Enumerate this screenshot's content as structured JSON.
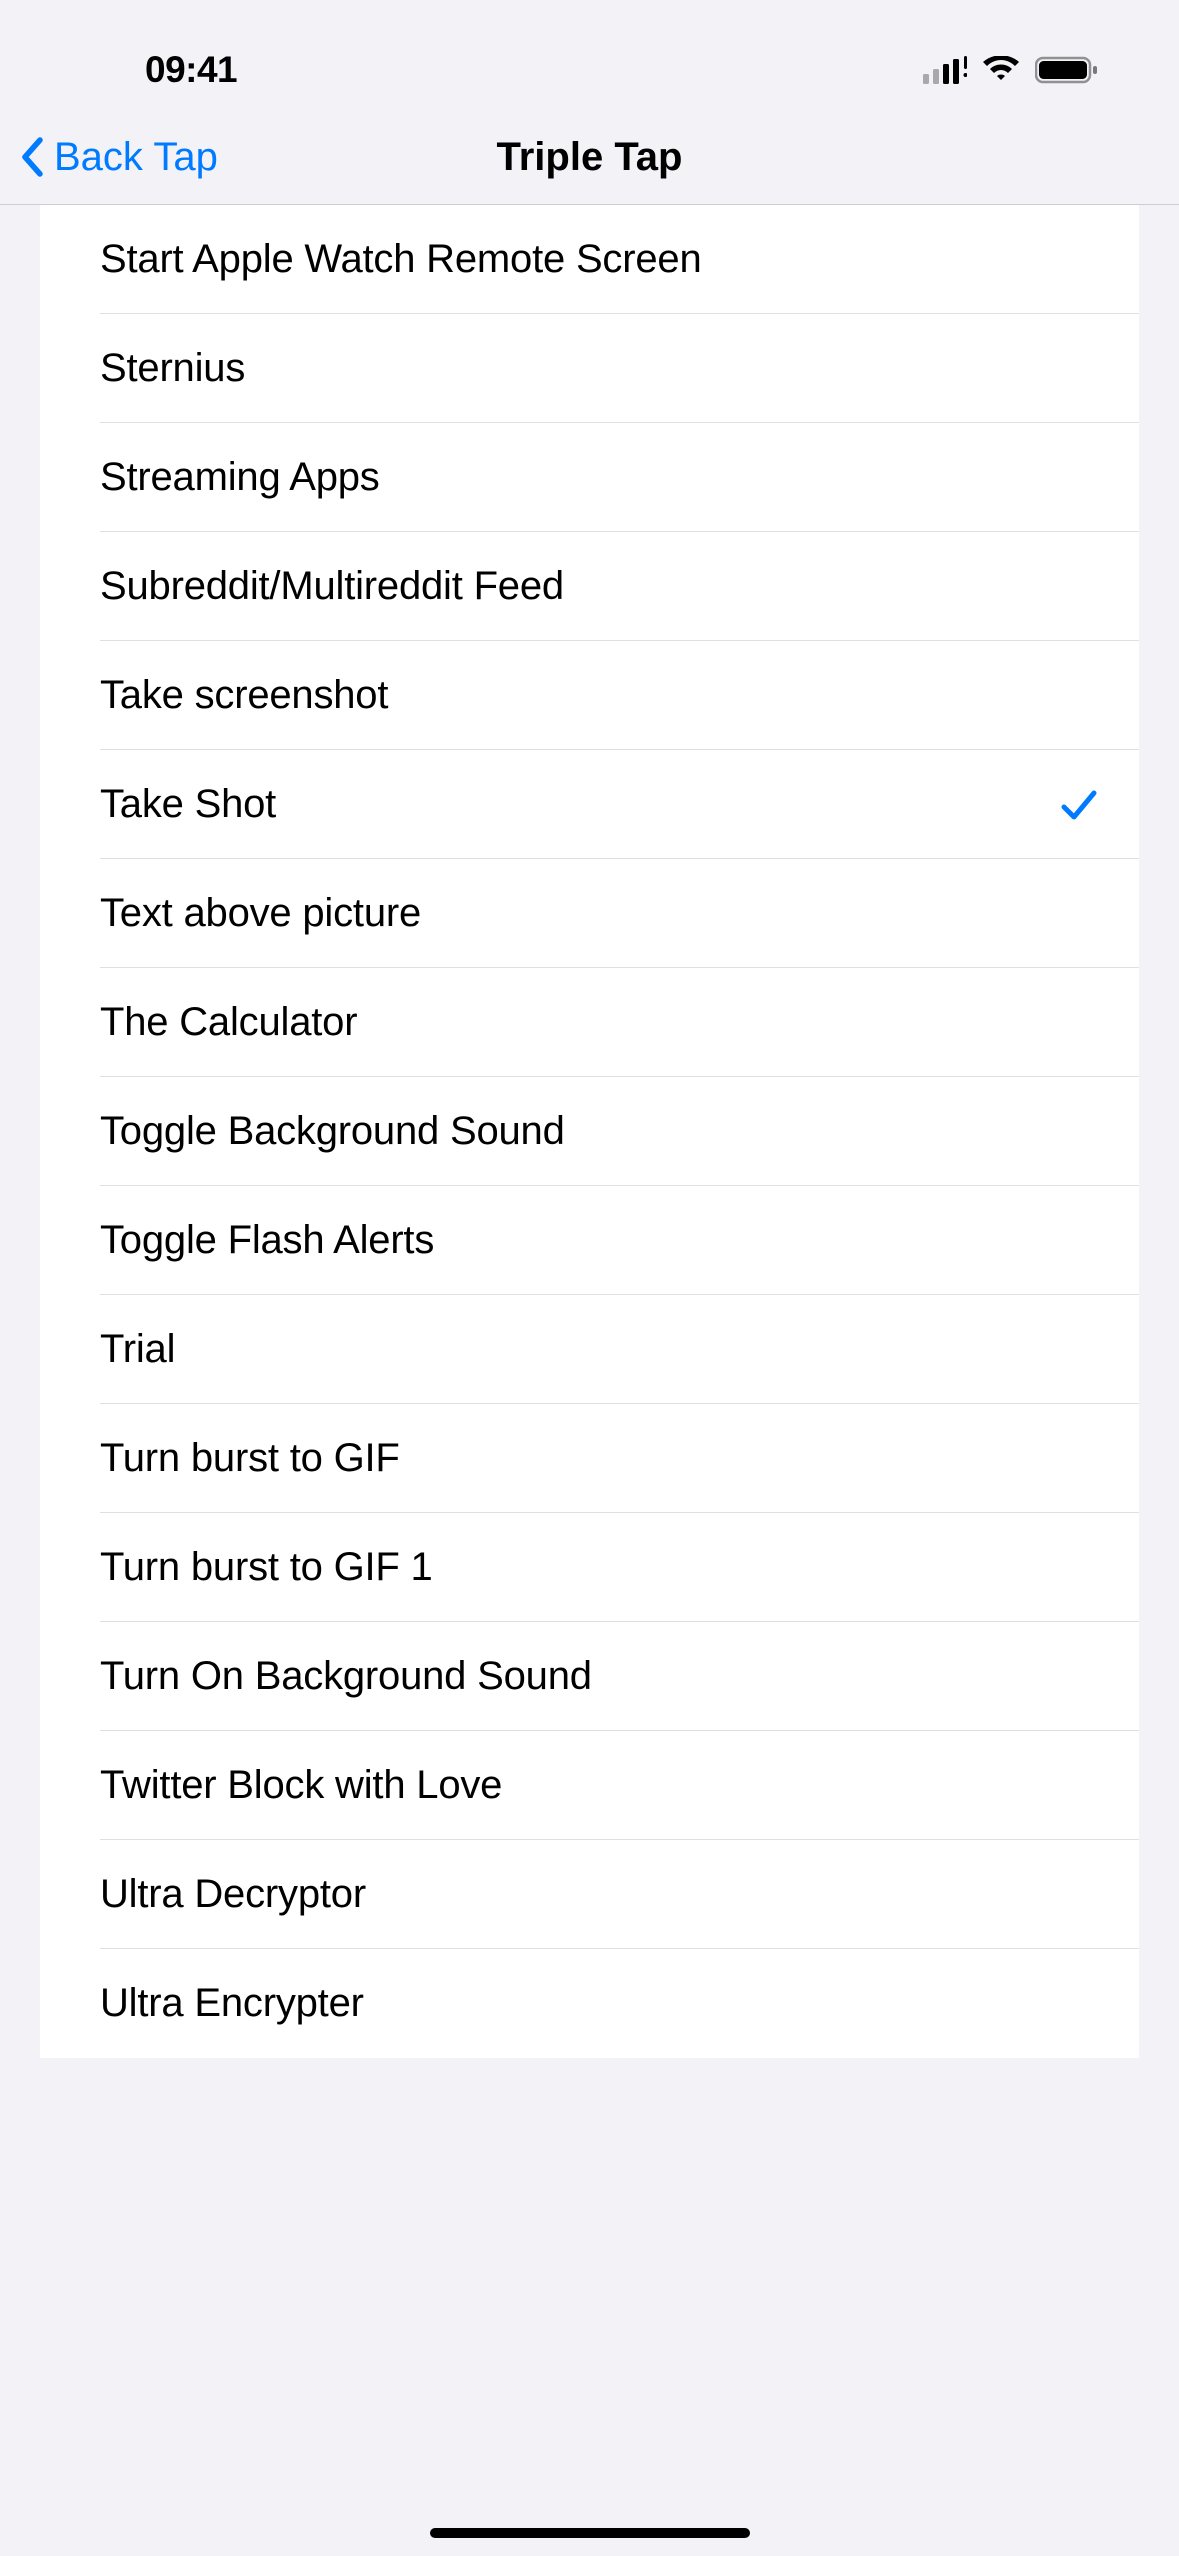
{
  "status": {
    "time": "09:41"
  },
  "nav": {
    "back_label": "Back Tap",
    "title": "Triple Tap"
  },
  "list": {
    "items": [
      {
        "label": "Start Apple Watch Remote Screen",
        "selected": false
      },
      {
        "label": "Sternius",
        "selected": false
      },
      {
        "label": "Streaming Apps",
        "selected": false
      },
      {
        "label": "Subreddit/Multireddit Feed",
        "selected": false
      },
      {
        "label": "Take screenshot",
        "selected": false
      },
      {
        "label": "Take Shot",
        "selected": true
      },
      {
        "label": "Text above picture",
        "selected": false
      },
      {
        "label": "The Calculator",
        "selected": false
      },
      {
        "label": "Toggle Background Sound",
        "selected": false
      },
      {
        "label": "Toggle Flash Alerts",
        "selected": false
      },
      {
        "label": "Trial",
        "selected": false
      },
      {
        "label": "Turn burst to GIF",
        "selected": false
      },
      {
        "label": "Turn burst to GIF 1",
        "selected": false
      },
      {
        "label": "Turn On Background Sound",
        "selected": false
      },
      {
        "label": "Twitter Block with Love",
        "selected": false
      },
      {
        "label": "Ultra Decryptor",
        "selected": false
      },
      {
        "label": "Ultra Encrypter",
        "selected": false
      }
    ]
  }
}
